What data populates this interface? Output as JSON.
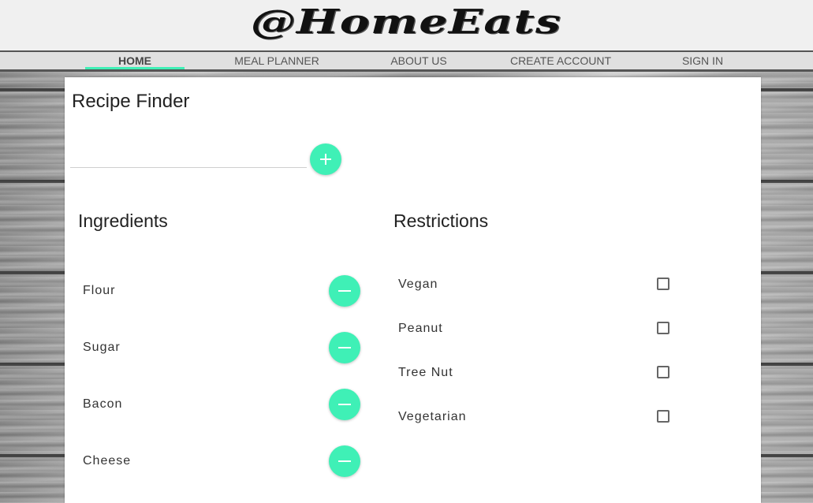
{
  "header": {
    "logo_text": "@HomeEats"
  },
  "nav": {
    "items": [
      {
        "label": "HOME",
        "active": true
      },
      {
        "label": "MEAL PLANNER",
        "active": false
      },
      {
        "label": "ABOUT US",
        "active": false
      },
      {
        "label": "CREATE ACCOUNT",
        "active": false
      },
      {
        "label": "SIGN IN",
        "active": false
      }
    ]
  },
  "recipe_finder": {
    "title": "Recipe Finder",
    "input_value": "",
    "input_placeholder": "",
    "add_icon": "plus-icon"
  },
  "ingredients": {
    "title": "Ingredients",
    "items": [
      {
        "label": "Flour",
        "remove_icon": "minus-icon"
      },
      {
        "label": "Sugar",
        "remove_icon": "minus-icon"
      },
      {
        "label": "Bacon",
        "remove_icon": "minus-icon"
      },
      {
        "label": "Cheese",
        "remove_icon": "minus-icon"
      }
    ]
  },
  "restrictions": {
    "title": "Restrictions",
    "items": [
      {
        "label": "Vegan",
        "checked": false
      },
      {
        "label": "Peanut",
        "checked": false
      },
      {
        "label": "Tree Nut",
        "checked": false
      },
      {
        "label": "Vegetarian",
        "checked": false
      }
    ]
  },
  "colors": {
    "accent": "#3ff0b6",
    "header_bg": "#f0f0f0",
    "nav_bg": "#e0e0e0",
    "card_bg": "#ffffff"
  }
}
